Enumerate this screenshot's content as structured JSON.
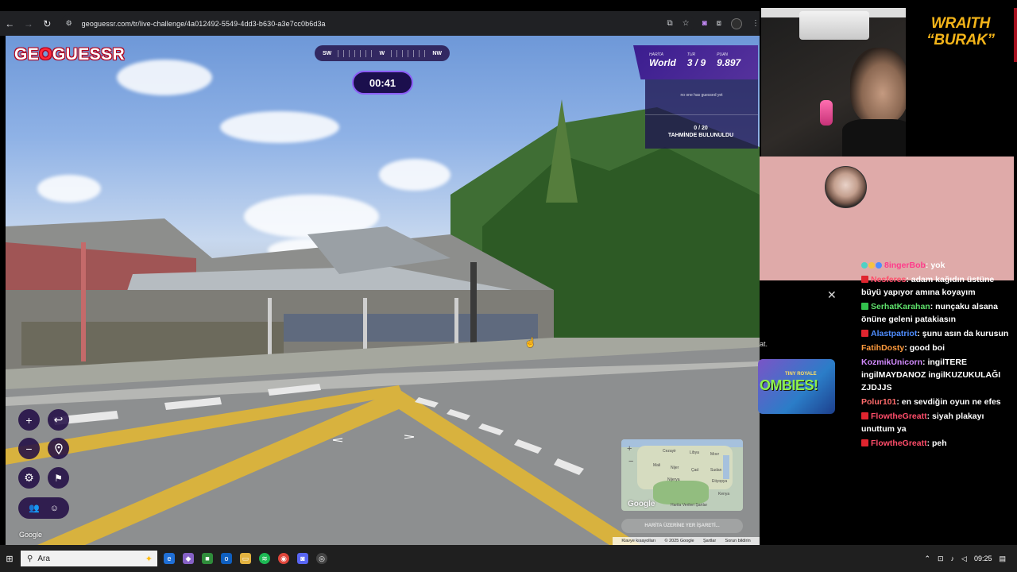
{
  "browser": {
    "url": "geoguessr.com/tr/live-challenge/4a012492-5549-4dd3-b630-a3e7cc0b6d3a",
    "icons": [
      "back-icon",
      "forward-icon",
      "reload-icon",
      "site-info-icon",
      "install-icon",
      "star-icon",
      "extension-puzzle-icon",
      "profile-icon",
      "menu-icon"
    ]
  },
  "game": {
    "logo": "GEOGUESSR",
    "compass": {
      "left": "SW",
      "center": "W",
      "right": "NW"
    },
    "timer": "00:41",
    "hud": {
      "map_label": "HARİTA",
      "map_value": "World",
      "round_label": "TUR",
      "round_value": "3 / 9",
      "score_label": "PUAN",
      "score_value": "9.897"
    },
    "guess_panel": {
      "none_text": "no one has guessed yet",
      "count": "0 / 20",
      "count_label": "TAHMİNDE BULUNULDU"
    },
    "controls": {
      "zoom_in": "+",
      "zoom_out": "−",
      "undo": "↩"
    },
    "minimap": {
      "labels": [
        "Cezayir",
        "Libya",
        "Mısır",
        "Mali",
        "Nijer",
        "Çad",
        "Sudan",
        "Nijerya",
        "Etiyopya",
        "Kenya"
      ],
      "google": "Google",
      "terms": "Harita Verileri   Şartlar",
      "guess_button": "HARİTA ÜZERİNE YER İŞARETİ..."
    },
    "sv_google": "Google",
    "attribution": [
      "Klavye kısayolları",
      "© 2025 Google",
      "Şartlar",
      "Sorun bildirin"
    ],
    "accent": "#8b5cf6"
  },
  "stream": {
    "brand_line1": "WRAITH",
    "brand_line2": "“BURAK”",
    "left_fragment": "at.",
    "game_ad": {
      "line1": "TINY ROYALE",
      "line2": "OMBIES!"
    },
    "chat": [
      {
        "user": "8ingerBob",
        "text": "yok",
        "color": "#ff3b8b",
        "badge": "multi"
      },
      {
        "user": "Nesferes",
        "text": "adam kağıdın üstüne büyü yapıyor amına koyayım",
        "color": "#ff4d6a",
        "badge": "red"
      },
      {
        "user": "SerhatKarahan",
        "text": "nunçaku alsana önüne geleni patakiasın",
        "color": "#5ee06b",
        "badge": "green"
      },
      {
        "user": "Alastpatriot",
        "text": "şunu asın da kurusun",
        "color": "#4f8dff",
        "badge": "red"
      },
      {
        "user": "FatihDosty",
        "text": "good boi",
        "color": "#ff9b3d",
        "badge": "none"
      },
      {
        "user": "KozmikUnicorn",
        "text": "ingilTERE ingilMAYDANOZ ingilKUZUKULAĞI ZJDJJS",
        "color": "#d38bff",
        "badge": "none"
      },
      {
        "user": "Polur101",
        "text": "en sevdiğin oyun ne efes",
        "color": "#ff6b6b",
        "badge": "none"
      },
      {
        "user": "FlowtheGreatt",
        "text": "siyah plakayı unuttum ya",
        "color": "#ff4d6a",
        "badge": "red"
      },
      {
        "user": "FlowtheGreatt",
        "text": "peh",
        "color": "#ff4d6a",
        "badge": "red"
      }
    ]
  },
  "taskbar": {
    "search_placeholder": "Ara",
    "time": "09:25"
  }
}
